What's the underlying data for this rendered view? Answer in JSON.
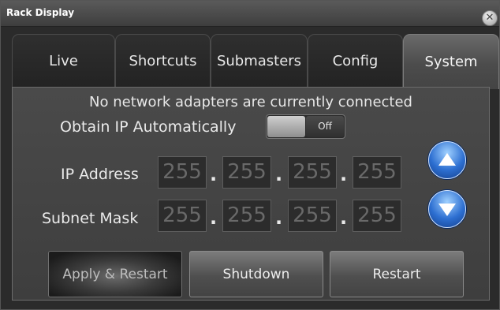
{
  "window": {
    "title": "Rack Display"
  },
  "tabs": [
    {
      "label": "Live"
    },
    {
      "label": "Shortcuts"
    },
    {
      "label": "Submasters"
    },
    {
      "label": "Config"
    },
    {
      "label": "System",
      "active": true
    }
  ],
  "system": {
    "status_message": "No network adapters are currently connected",
    "obtain_ip_label": "Obtain IP Automatically",
    "obtain_ip_state": "Off",
    "ip_label": "IP Address",
    "subnet_label": "Subnet Mask",
    "ip_octets": [
      "255",
      "255",
      "255",
      "255"
    ],
    "subnet_octets": [
      "255",
      "255",
      "255",
      "255"
    ],
    "separator": "."
  },
  "actions": {
    "apply_restart": "Apply & Restart",
    "shutdown": "Shutdown",
    "restart": "Restart"
  },
  "icons": {
    "close": "close-icon",
    "up": "arrow-up-icon",
    "down": "arrow-down-icon"
  },
  "colors": {
    "accent_blue": "#2d6fd1"
  }
}
